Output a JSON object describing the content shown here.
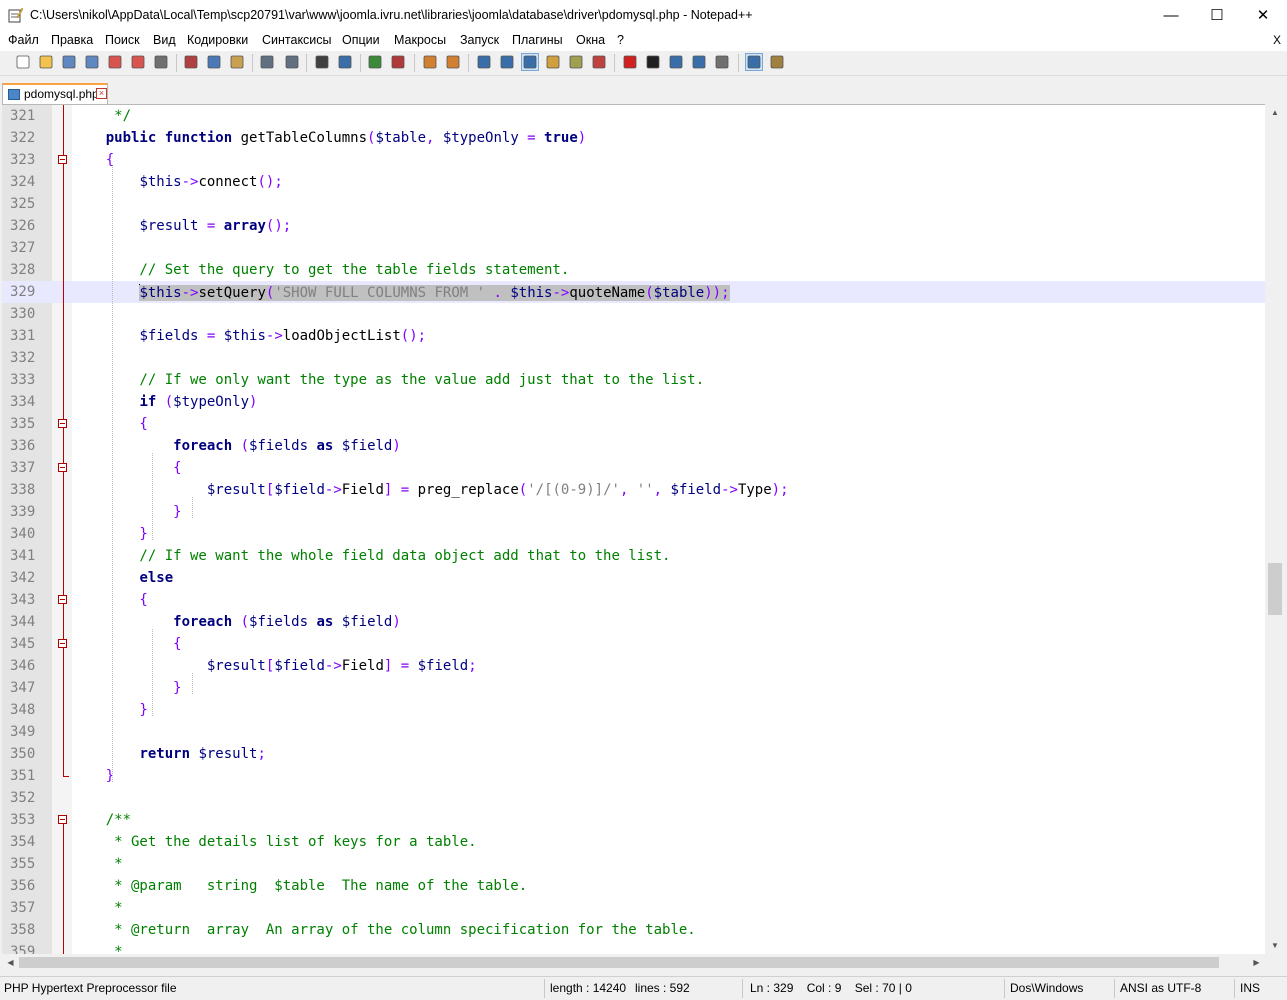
{
  "window": {
    "title": "C:\\Users\\nikol\\AppData\\Local\\Temp\\scp20791\\var\\www\\joomla.ivru.net\\libraries\\joomla\\database\\driver\\pdomysql.php - Notepad++",
    "minimize": "—",
    "maximize": "☐",
    "close": "✕"
  },
  "menu": {
    "items": [
      "Файл",
      "Правка",
      "Поиск",
      "Вид",
      "Кодировки",
      "Синтаксисы",
      "Опции",
      "Макросы",
      "Запуск",
      "Плагины",
      "Окна",
      "?"
    ],
    "close_doc": "X"
  },
  "toolbar": {
    "buttons": [
      {
        "name": "new-file-icon",
        "color": "#ffffff"
      },
      {
        "name": "open-file-icon",
        "color": "#f2c14e"
      },
      {
        "name": "save-icon",
        "color": "#5f87c0"
      },
      {
        "name": "save-all-icon",
        "color": "#5f87c0"
      },
      {
        "name": "close-icon",
        "color": "#d9534f"
      },
      {
        "name": "close-all-icon",
        "color": "#d9534f"
      },
      {
        "name": "print-icon",
        "color": "#707070"
      },
      {
        "name": "cut-icon",
        "color": "#b04040"
      },
      {
        "name": "copy-icon",
        "color": "#4a78b8"
      },
      {
        "name": "paste-icon",
        "color": "#c8a050"
      },
      {
        "name": "undo-icon",
        "color": "#607080"
      },
      {
        "name": "redo-icon",
        "color": "#607080"
      },
      {
        "name": "find-icon",
        "color": "#404040"
      },
      {
        "name": "replace-icon",
        "color": "#3a6ea8"
      },
      {
        "name": "zoom-in-icon",
        "color": "#3a8a3a"
      },
      {
        "name": "zoom-out-icon",
        "color": "#b03a3a"
      },
      {
        "name": "sync-vertical-icon",
        "color": "#d08030"
      },
      {
        "name": "sync-horizontal-icon",
        "color": "#d08030"
      },
      {
        "name": "word-wrap-icon",
        "color": "#3a6ea8"
      },
      {
        "name": "show-all-chars-icon",
        "color": "#3a6ea8"
      },
      {
        "name": "indent-guide-icon",
        "color": "#3a6ea8"
      },
      {
        "name": "user-language-icon",
        "color": "#d0a040"
      },
      {
        "name": "doc-map-icon",
        "color": "#a0a050"
      },
      {
        "name": "function-list-icon",
        "color": "#c04040"
      },
      {
        "name": "record-macro-icon",
        "color": "#d02020"
      },
      {
        "name": "stop-record-icon",
        "color": "#202020"
      },
      {
        "name": "play-macro-icon",
        "color": "#3a6ea8"
      },
      {
        "name": "run-macro-multiple-icon",
        "color": "#3a6ea8"
      },
      {
        "name": "save-macro-icon",
        "color": "#707070"
      },
      {
        "name": "spell-check-icon",
        "color": "#3a6ea8"
      },
      {
        "name": "spell-options-icon",
        "color": "#a08040"
      }
    ]
  },
  "tab": {
    "label": "pdomysql.php",
    "close": "×"
  },
  "colors": {
    "keyword": "#00007f",
    "comment": "#008000",
    "string": "#808080",
    "operator": "#8000ff",
    "variable": "#000080",
    "plain": "#000000",
    "linenum": "#808080",
    "current_line": "#e8e8ff",
    "fold_marker": "#c00000"
  },
  "editor": {
    "lines": [
      {
        "num": "321",
        "tokens": [
          {
            "t": "     */",
            "c": "comment"
          }
        ]
      },
      {
        "num": "322",
        "tokens": [
          {
            "t": "    ",
            "c": "plain"
          },
          {
            "t": "public function",
            "c": "keyword"
          },
          {
            "t": " getTableColumns",
            "c": "plain"
          },
          {
            "t": "(",
            "c": "operator"
          },
          {
            "t": "$table",
            "c": "variable"
          },
          {
            "t": ", ",
            "c": "operator"
          },
          {
            "t": "$typeOnly",
            "c": "variable"
          },
          {
            "t": " = ",
            "c": "operator"
          },
          {
            "t": "true",
            "c": "keyword"
          },
          {
            "t": ")",
            "c": "operator"
          }
        ]
      },
      {
        "num": "323",
        "tokens": [
          {
            "t": "    {",
            "c": "operator"
          }
        ]
      },
      {
        "num": "324",
        "tokens": [
          {
            "t": "        ",
            "c": "plain"
          },
          {
            "t": "$this",
            "c": "variable"
          },
          {
            "t": "->",
            "c": "operator"
          },
          {
            "t": "connect",
            "c": "plain"
          },
          {
            "t": "();",
            "c": "operator"
          }
        ]
      },
      {
        "num": "325",
        "tokens": []
      },
      {
        "num": "326",
        "tokens": [
          {
            "t": "        ",
            "c": "plain"
          },
          {
            "t": "$result",
            "c": "variable"
          },
          {
            "t": " = ",
            "c": "operator"
          },
          {
            "t": "array",
            "c": "keyword"
          },
          {
            "t": "();",
            "c": "operator"
          }
        ]
      },
      {
        "num": "327",
        "tokens": []
      },
      {
        "num": "328",
        "tokens": [
          {
            "t": "        // Set the query to get the table fields statement.",
            "c": "comment"
          }
        ]
      },
      {
        "num": "329",
        "current": true,
        "tokens": [
          {
            "t": "        ",
            "c": "plain"
          },
          {
            "t": "$this",
            "c": "variable",
            "sel": true,
            "caret": true
          },
          {
            "t": "->",
            "c": "operator",
            "sel": true
          },
          {
            "t": "setQuery",
            "c": "plain",
            "sel": true
          },
          {
            "t": "(",
            "c": "operator",
            "sel": true
          },
          {
            "t": "'SHOW FULL COLUMNS FROM '",
            "c": "string",
            "sel": true
          },
          {
            "t": " . ",
            "c": "operator",
            "sel": true
          },
          {
            "t": "$this",
            "c": "variable",
            "sel": true
          },
          {
            "t": "->",
            "c": "operator",
            "sel": true
          },
          {
            "t": "quoteName",
            "c": "plain",
            "sel": true
          },
          {
            "t": "(",
            "c": "operator",
            "sel": true
          },
          {
            "t": "$table",
            "c": "variable",
            "sel": true
          },
          {
            "t": "));",
            "c": "operator",
            "sel": true
          }
        ]
      },
      {
        "num": "330",
        "tokens": []
      },
      {
        "num": "331",
        "tokens": [
          {
            "t": "        ",
            "c": "plain"
          },
          {
            "t": "$fields",
            "c": "variable"
          },
          {
            "t": " = ",
            "c": "operator"
          },
          {
            "t": "$this",
            "c": "variable"
          },
          {
            "t": "->",
            "c": "operator"
          },
          {
            "t": "loadObjectList",
            "c": "plain"
          },
          {
            "t": "();",
            "c": "operator"
          }
        ]
      },
      {
        "num": "332",
        "tokens": []
      },
      {
        "num": "333",
        "tokens": [
          {
            "t": "        // If we only want the type as the value add just that to the list.",
            "c": "comment"
          }
        ]
      },
      {
        "num": "334",
        "tokens": [
          {
            "t": "        ",
            "c": "plain"
          },
          {
            "t": "if",
            "c": "keyword"
          },
          {
            "t": " (",
            "c": "operator"
          },
          {
            "t": "$typeOnly",
            "c": "variable"
          },
          {
            "t": ")",
            "c": "operator"
          }
        ]
      },
      {
        "num": "335",
        "tokens": [
          {
            "t": "        {",
            "c": "operator"
          }
        ]
      },
      {
        "num": "336",
        "tokens": [
          {
            "t": "            ",
            "c": "plain"
          },
          {
            "t": "foreach",
            "c": "keyword"
          },
          {
            "t": " (",
            "c": "operator"
          },
          {
            "t": "$fields",
            "c": "variable"
          },
          {
            "t": " ",
            "c": "plain"
          },
          {
            "t": "as",
            "c": "keyword"
          },
          {
            "t": " ",
            "c": "plain"
          },
          {
            "t": "$field",
            "c": "variable"
          },
          {
            "t": ")",
            "c": "operator"
          }
        ]
      },
      {
        "num": "337",
        "tokens": [
          {
            "t": "            {",
            "c": "operator"
          }
        ]
      },
      {
        "num": "338",
        "tokens": [
          {
            "t": "                ",
            "c": "plain"
          },
          {
            "t": "$result",
            "c": "variable"
          },
          {
            "t": "[",
            "c": "operator"
          },
          {
            "t": "$field",
            "c": "variable"
          },
          {
            "t": "->",
            "c": "operator"
          },
          {
            "t": "Field",
            "c": "plain"
          },
          {
            "t": "] = ",
            "c": "operator"
          },
          {
            "t": "preg_replace",
            "c": "plain"
          },
          {
            "t": "(",
            "c": "operator"
          },
          {
            "t": "'/[(0-9)]/'",
            "c": "string"
          },
          {
            "t": ", ",
            "c": "operator"
          },
          {
            "t": "''",
            "c": "string"
          },
          {
            "t": ", ",
            "c": "operator"
          },
          {
            "t": "$field",
            "c": "variable"
          },
          {
            "t": "->",
            "c": "operator"
          },
          {
            "t": "Type",
            "c": "plain"
          },
          {
            "t": ");",
            "c": "operator"
          }
        ]
      },
      {
        "num": "339",
        "tokens": [
          {
            "t": "            }",
            "c": "operator"
          }
        ]
      },
      {
        "num": "340",
        "tokens": [
          {
            "t": "        }",
            "c": "operator"
          }
        ]
      },
      {
        "num": "341",
        "tokens": [
          {
            "t": "        // If we want the whole field data object add that to the list.",
            "c": "comment"
          }
        ]
      },
      {
        "num": "342",
        "tokens": [
          {
            "t": "        ",
            "c": "plain"
          },
          {
            "t": "else",
            "c": "keyword"
          }
        ]
      },
      {
        "num": "343",
        "tokens": [
          {
            "t": "        {",
            "c": "operator"
          }
        ]
      },
      {
        "num": "344",
        "tokens": [
          {
            "t": "            ",
            "c": "plain"
          },
          {
            "t": "foreach",
            "c": "keyword"
          },
          {
            "t": " (",
            "c": "operator"
          },
          {
            "t": "$fields",
            "c": "variable"
          },
          {
            "t": " ",
            "c": "plain"
          },
          {
            "t": "as",
            "c": "keyword"
          },
          {
            "t": " ",
            "c": "plain"
          },
          {
            "t": "$field",
            "c": "variable"
          },
          {
            "t": ")",
            "c": "operator"
          }
        ]
      },
      {
        "num": "345",
        "tokens": [
          {
            "t": "            {",
            "c": "operator"
          }
        ]
      },
      {
        "num": "346",
        "tokens": [
          {
            "t": "                ",
            "c": "plain"
          },
          {
            "t": "$result",
            "c": "variable"
          },
          {
            "t": "[",
            "c": "operator"
          },
          {
            "t": "$field",
            "c": "variable"
          },
          {
            "t": "->",
            "c": "operator"
          },
          {
            "t": "Field",
            "c": "plain"
          },
          {
            "t": "] = ",
            "c": "operator"
          },
          {
            "t": "$field",
            "c": "variable"
          },
          {
            "t": ";",
            "c": "operator"
          }
        ]
      },
      {
        "num": "347",
        "tokens": [
          {
            "t": "            }",
            "c": "operator"
          }
        ]
      },
      {
        "num": "348",
        "tokens": [
          {
            "t": "        }",
            "c": "operator"
          }
        ]
      },
      {
        "num": "349",
        "tokens": []
      },
      {
        "num": "350",
        "tokens": [
          {
            "t": "        ",
            "c": "plain"
          },
          {
            "t": "return",
            "c": "keyword"
          },
          {
            "t": " ",
            "c": "plain"
          },
          {
            "t": "$result",
            "c": "variable"
          },
          {
            "t": ";",
            "c": "operator"
          }
        ]
      },
      {
        "num": "351",
        "tokens": [
          {
            "t": "    }",
            "c": "operator"
          }
        ]
      },
      {
        "num": "352",
        "tokens": []
      },
      {
        "num": "353",
        "tokens": [
          {
            "t": "    /**",
            "c": "comment"
          }
        ]
      },
      {
        "num": "354",
        "tokens": [
          {
            "t": "     * Get the details list of keys for a table.",
            "c": "comment"
          }
        ]
      },
      {
        "num": "355",
        "tokens": [
          {
            "t": "     *",
            "c": "comment"
          }
        ]
      },
      {
        "num": "356",
        "tokens": [
          {
            "t": "     * @param   string  $table  The name of the table.",
            "c": "comment"
          }
        ]
      },
      {
        "num": "357",
        "tokens": [
          {
            "t": "     *",
            "c": "comment"
          }
        ]
      },
      {
        "num": "358",
        "tokens": [
          {
            "t": "     * @return  array  An array of the column specification for the table.",
            "c": "comment"
          }
        ]
      },
      {
        "num": "359",
        "tokens": [
          {
            "t": "     *",
            "c": "comment"
          }
        ]
      }
    ]
  },
  "status": {
    "file_type": "PHP Hypertext Preprocessor file",
    "length": "length : 14240",
    "lines": "lines : 592",
    "position": "Ln : 329    Col : 9    Sel : 70 | 0",
    "eol": "Dos\\Windows",
    "encoding": "ANSI as UTF-8",
    "mode": "INS"
  }
}
